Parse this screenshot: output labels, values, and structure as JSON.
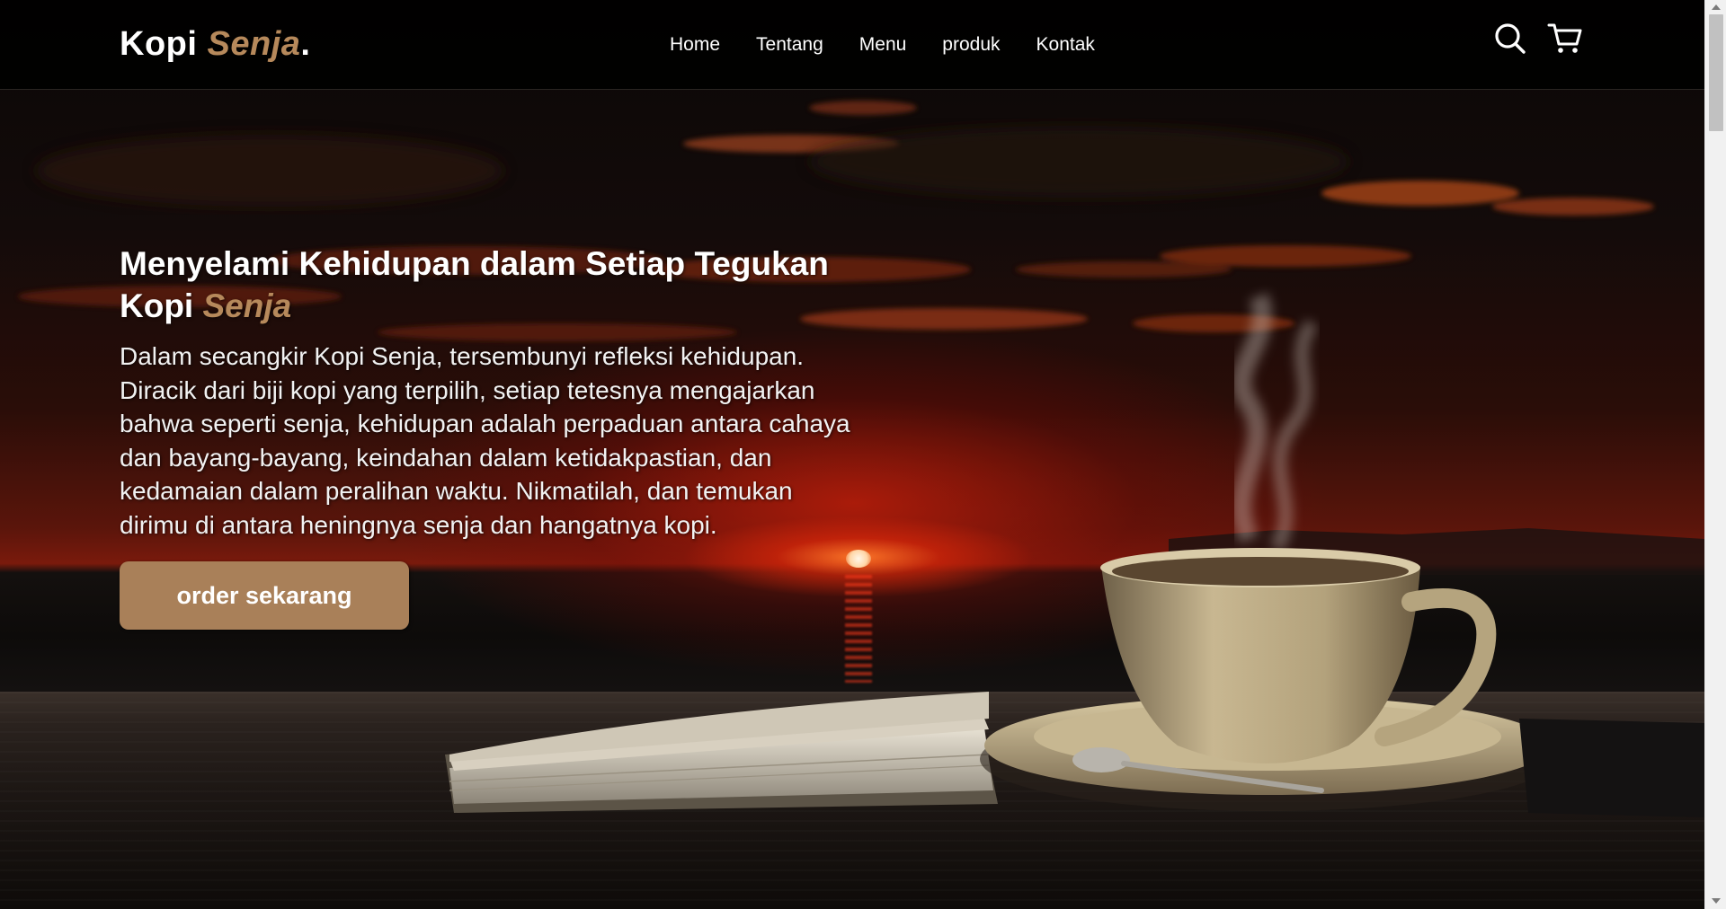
{
  "brand": {
    "name": "Kopi",
    "accent": "Senja",
    "dot": ".",
    "accent_color": "#b6895b"
  },
  "nav": {
    "links": [
      {
        "label": "Home"
      },
      {
        "label": "Tentang"
      },
      {
        "label": "Menu"
      },
      {
        "label": "produk"
      },
      {
        "label": "Kontak"
      }
    ],
    "icons": [
      "search-icon",
      "shopping-cart-icon"
    ]
  },
  "hero": {
    "title_main": "Menyelami Kehidupan dalam Setiap Tegukan Kopi ",
    "title_accent": "Senja",
    "text": "Dalam secangkir Kopi Senja, tersembunyi refleksi kehidupan. Diracik dari biji kopi yang terpilih, setiap tetesnya mengajarkan bahwa seperti senja, kehidupan adalah perpaduan antara cahaya dan bayang-bayang, keindahan dalam ketidakpastian, dan kedamaian dalam peralihan waktu. Nikmatilah, dan temukan dirimu di antara heningnya senja dan hangatnya kopi.",
    "cta_label": "order sekarang",
    "cta_color": "#a98059"
  }
}
